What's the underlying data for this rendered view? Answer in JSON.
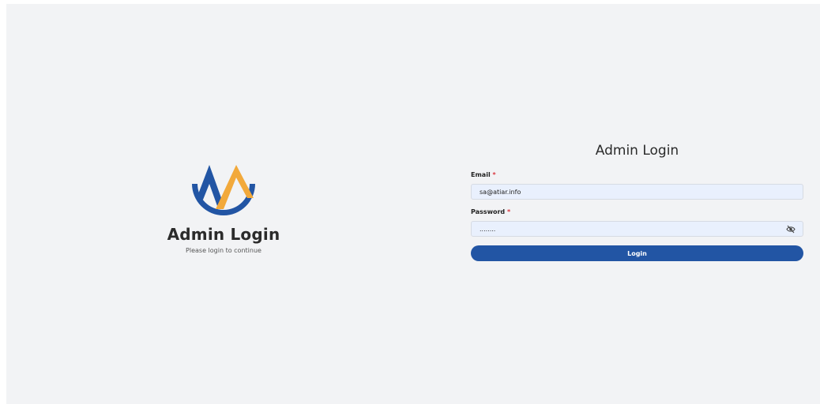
{
  "brand": {
    "title": "Admin Login",
    "subtitle": "Please login to continue",
    "logo_icon": "mountain-arc-logo",
    "colors": {
      "blue": "#2255a4",
      "orange": "#f2a93b"
    }
  },
  "form": {
    "title": "Admin Login",
    "email": {
      "label": "Email",
      "required_mark": "*",
      "value": "sa@atiar.info"
    },
    "password": {
      "label": "Password",
      "required_mark": "*",
      "value": "........",
      "toggle_icon": "eye-off-icon"
    },
    "submit_label": "Login"
  },
  "colors": {
    "background": "#f2f3f5",
    "input_background": "#e9f0fd",
    "primary": "#2255a4",
    "required": "#d9363e"
  }
}
